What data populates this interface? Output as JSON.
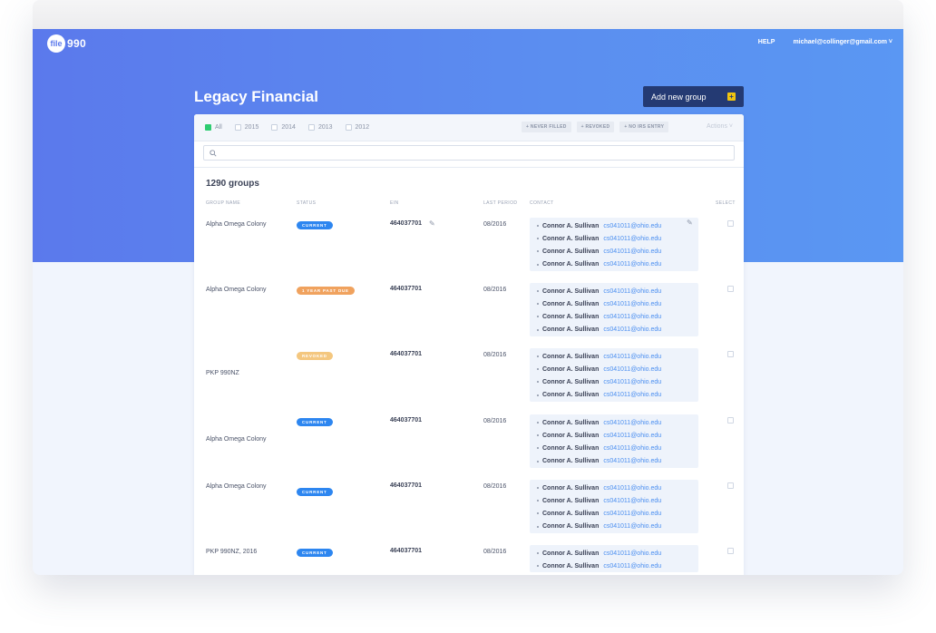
{
  "app": {
    "logo_mark": "file",
    "logo_text": "990"
  },
  "topnav": {
    "help": "HELP",
    "user": "michael@collinger@gmail.com ˅"
  },
  "page": {
    "title": "Legacy Financial",
    "add_button": "Add new group"
  },
  "filters": {
    "years": [
      {
        "label": "All",
        "checked": true
      },
      {
        "label": "2015",
        "checked": false
      },
      {
        "label": "2014",
        "checked": false
      },
      {
        "label": "2013",
        "checked": false
      },
      {
        "label": "2012",
        "checked": false
      }
    ],
    "tags": [
      "+ NEVER FILLED",
      "+ REVOKED",
      "+ NO IRS ENTRY"
    ],
    "actions": "Actions ˅"
  },
  "search": {
    "placeholder": ""
  },
  "summary": {
    "count": "1290 groups"
  },
  "columns": {
    "group": "GROUP NAME",
    "status": "STATUS",
    "ein": "EIN",
    "period": "LAST PERIOD",
    "contact": "CONTACT",
    "select": "SELECT"
  },
  "status_colors": {
    "current": "#2d86f0",
    "past_due": "#f0a25e",
    "revoked": "#f4c77f"
  },
  "rows": [
    {
      "name": "Alpha Omega Colony",
      "status": "CURRENT",
      "status_color": "#2d86f0",
      "ein": "464037701",
      "period": "08/2016",
      "editable": true,
      "contacts": [
        {
          "name": "Connor A. Sullivan",
          "email": "cs041011@ohio.edu"
        },
        {
          "name": "Connor A. Sullivan",
          "email": "cs041011@ohio.edu"
        },
        {
          "name": "Connor A. Sullivan",
          "email": "cs041011@ohio.edu"
        },
        {
          "name": "Connor A. Sullivan",
          "email": "cs041011@ohio.edu"
        }
      ]
    },
    {
      "name": "Alpha Omega Colony",
      "status": "1 YEAR PAST DUE",
      "status_color": "#f0a25e",
      "ein": "464037701",
      "period": "08/2016",
      "editable": false,
      "contacts": [
        {
          "name": "Connor A. Sullivan",
          "email": "cs041011@ohio.edu"
        },
        {
          "name": "Connor A. Sullivan",
          "email": "cs041011@ohio.edu"
        },
        {
          "name": "Connor A. Sullivan",
          "email": "cs041011@ohio.edu"
        },
        {
          "name": "Connor A. Sullivan",
          "email": "cs041011@ohio.edu"
        }
      ]
    },
    {
      "name": "PKP 990NZ",
      "status": "REVOKED",
      "status_color": "#f4c77f",
      "ein": "464037701",
      "period": "08/2016",
      "editable": false,
      "contacts": [
        {
          "name": "Connor A. Sullivan",
          "email": "cs041011@ohio.edu"
        },
        {
          "name": "Connor A. Sullivan",
          "email": "cs041011@ohio.edu"
        },
        {
          "name": "Connor A. Sullivan",
          "email": "cs041011@ohio.edu"
        },
        {
          "name": "Connor A. Sullivan",
          "email": "cs041011@ohio.edu"
        }
      ]
    },
    {
      "name": "Alpha Omega Colony",
      "status": "CURRENT",
      "status_color": "#2d86f0",
      "ein": "464037701",
      "period": "08/2016",
      "editable": false,
      "contacts": [
        {
          "name": "Connor A. Sullivan",
          "email": "cs041011@ohio.edu"
        },
        {
          "name": "Connor A. Sullivan",
          "email": "cs041011@ohio.edu"
        },
        {
          "name": "Connor A. Sullivan",
          "email": "cs041011@ohio.edu"
        },
        {
          "name": "Connor A. Sullivan",
          "email": "cs041011@ohio.edu"
        }
      ]
    },
    {
      "name": "Alpha Omega Colony",
      "status": "CURRENT",
      "status_color": "#2d86f0",
      "ein": "464037701",
      "period": "08/2016",
      "editable": false,
      "contacts": [
        {
          "name": "Connor A. Sullivan",
          "email": "cs041011@ohio.edu"
        },
        {
          "name": "Connor A. Sullivan",
          "email": "cs041011@ohio.edu"
        },
        {
          "name": "Connor A. Sullivan",
          "email": "cs041011@ohio.edu"
        },
        {
          "name": "Connor A. Sullivan",
          "email": "cs041011@ohio.edu"
        }
      ]
    },
    {
      "name": "PKP 990NZ, 2016",
      "status": "CURRENT",
      "status_color": "#2d86f0",
      "ein": "464037701",
      "period": "08/2016",
      "editable": false,
      "contacts": [
        {
          "name": "Connor A. Sullivan",
          "email": "cs041011@ohio.edu"
        },
        {
          "name": "Connor A. Sullivan",
          "email": "cs041011@ohio.edu"
        }
      ]
    }
  ]
}
